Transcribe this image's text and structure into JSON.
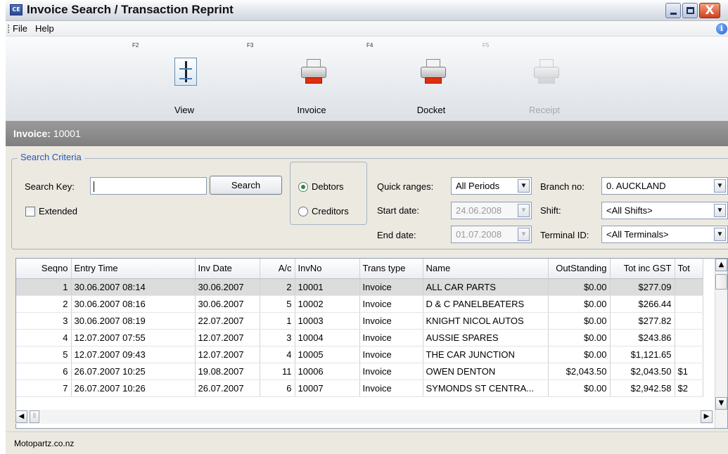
{
  "window": {
    "title": "Invoice Search / Transaction Reprint",
    "app_icon_text": "CE",
    "close_glyph": "X"
  },
  "menu": {
    "items": [
      "File",
      "Help"
    ],
    "info_icon": "info-icon"
  },
  "toolbar": {
    "tools": [
      {
        "key": "F2",
        "label": "View",
        "icon": "document-icon",
        "enabled": true
      },
      {
        "key": "F3",
        "label": "Invoice",
        "icon": "printer-icon",
        "enabled": true
      },
      {
        "key": "F4",
        "label": "Docket",
        "icon": "printer-icon",
        "enabled": true
      },
      {
        "key": "F5",
        "label": "Receipt",
        "icon": "printer-icon",
        "enabled": false
      }
    ]
  },
  "invoice_band": {
    "label": "Invoice:",
    "value": "10001"
  },
  "search": {
    "group_title": "Search Criteria",
    "key_label": "Search Key:",
    "key_value": "",
    "search_button": "Search",
    "extended_label": "Extended",
    "extended_checked": false,
    "account_type": {
      "options": [
        "Debtors",
        "Creditors"
      ],
      "selected": "Debtors"
    },
    "quick_ranges_label": "Quick ranges:",
    "quick_ranges_value": "All Periods",
    "start_date_label": "Start date:",
    "start_date_value": "24.06.2008",
    "end_date_label": "End date:",
    "end_date_value": "01.07.2008",
    "branch_label": "Branch no:",
    "branch_value": "0. AUCKLAND",
    "shift_label": "Shift:",
    "shift_value": "<All Shifts>",
    "terminal_label": "Terminal ID:",
    "terminal_value": "<All Terminals>"
  },
  "grid": {
    "columns": [
      "Seqno",
      "Entry Time",
      "Inv Date",
      "A/c",
      "InvNo",
      "Trans type",
      "Name",
      "OutStanding",
      "Tot inc GST",
      "Tot"
    ],
    "rows": [
      [
        "1",
        "30.06.2007 08:14",
        "30.06.2007",
        "2",
        "10001",
        "Invoice",
        "ALL CAR PARTS",
        "$0.00",
        "$277.09",
        ""
      ],
      [
        "2",
        "30.06.2007 08:16",
        "30.06.2007",
        "5",
        "10002",
        "Invoice",
        "D & C PANELBEATERS",
        "$0.00",
        "$266.44",
        ""
      ],
      [
        "3",
        "30.06.2007 08:19",
        "22.07.2007",
        "1",
        "10003",
        "Invoice",
        "KNIGHT NICOL AUTOS",
        "$0.00",
        "$277.82",
        ""
      ],
      [
        "4",
        "12.07.2007 07:55",
        "12.07.2007",
        "3",
        "10004",
        "Invoice",
        "AUSSIE SPARES",
        "$0.00",
        "$243.86",
        ""
      ],
      [
        "5",
        "12.07.2007 09:43",
        "12.07.2007",
        "4",
        "10005",
        "Invoice",
        "THE CAR JUNCTION",
        "$0.00",
        "$1,121.65",
        ""
      ],
      [
        "6",
        "26.07.2007 10:25",
        "19.08.2007",
        "11",
        "10006",
        "Invoice",
        "OWEN DENTON",
        "$2,043.50",
        "$2,043.50",
        "$1"
      ],
      [
        "7",
        "26.07.2007 10:26",
        "26.07.2007",
        "6",
        "10007",
        "Invoice",
        "SYMONDS ST CENTRA...",
        "$0.00",
        "$2,942.58",
        "$2"
      ]
    ],
    "selected_row": 0
  },
  "status": {
    "text": "Motopartz.co.nz"
  }
}
